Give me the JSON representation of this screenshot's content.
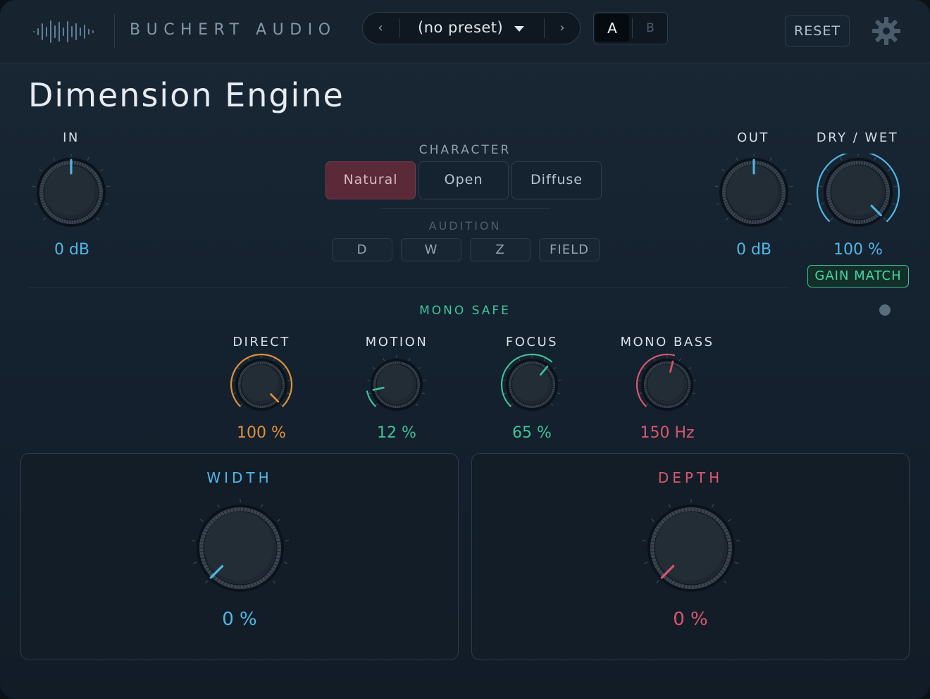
{
  "header": {
    "brand": "BUCHERT AUDIO",
    "preset_prev": "‹",
    "preset_name": "(no preset)",
    "preset_next": "›",
    "ab_a": "A",
    "ab_b": "B",
    "reset_label": "RESET",
    "settings_icon": "gear-icon",
    "logo_icon": "waveform-logo-icon"
  },
  "title": "Dimension Engine",
  "in_knob": {
    "label": "IN",
    "value": "0 dB",
    "level": 0.5
  },
  "out_knob": {
    "label": "OUT",
    "value": "0 dB",
    "level": 0.5
  },
  "drywet_knob": {
    "label": "DRY / WET",
    "value": "100 %",
    "level": 1.0
  },
  "gain_match_label": "GAIN MATCH",
  "character": {
    "label": "CHARACTER",
    "options": [
      "Natural",
      "Open",
      "Diffuse"
    ],
    "selected": "Natural"
  },
  "audition": {
    "label": "AUDITION",
    "buttons": [
      "D",
      "W",
      "Z",
      "FIELD"
    ]
  },
  "mono_safe_label": "MONO SAFE",
  "small_knobs": [
    {
      "label": "DIRECT",
      "value": "100 %",
      "level": 1.0,
      "color": "#e0913a"
    },
    {
      "label": "MOTION",
      "value": "12 %",
      "level": 0.12,
      "color": "#3ec29a"
    },
    {
      "label": "FOCUS",
      "value": "65 %",
      "level": 0.65,
      "color": "#3ec29a"
    },
    {
      "label": "MONO BASS",
      "value": "150 Hz",
      "level": 0.55,
      "color": "#d9566f"
    }
  ],
  "width_panel": {
    "title": "WIDTH",
    "value": "0 %",
    "level": 0.0,
    "color": "#4fb7e6"
  },
  "depth_panel": {
    "title": "DEPTH",
    "value": "0 %",
    "level": 0.0,
    "color": "#d9566f"
  },
  "colors": {
    "accent_blue": "#4fb7e6",
    "accent_green": "#3ec29a",
    "accent_orange": "#e0913a",
    "accent_pink": "#d9566f"
  }
}
